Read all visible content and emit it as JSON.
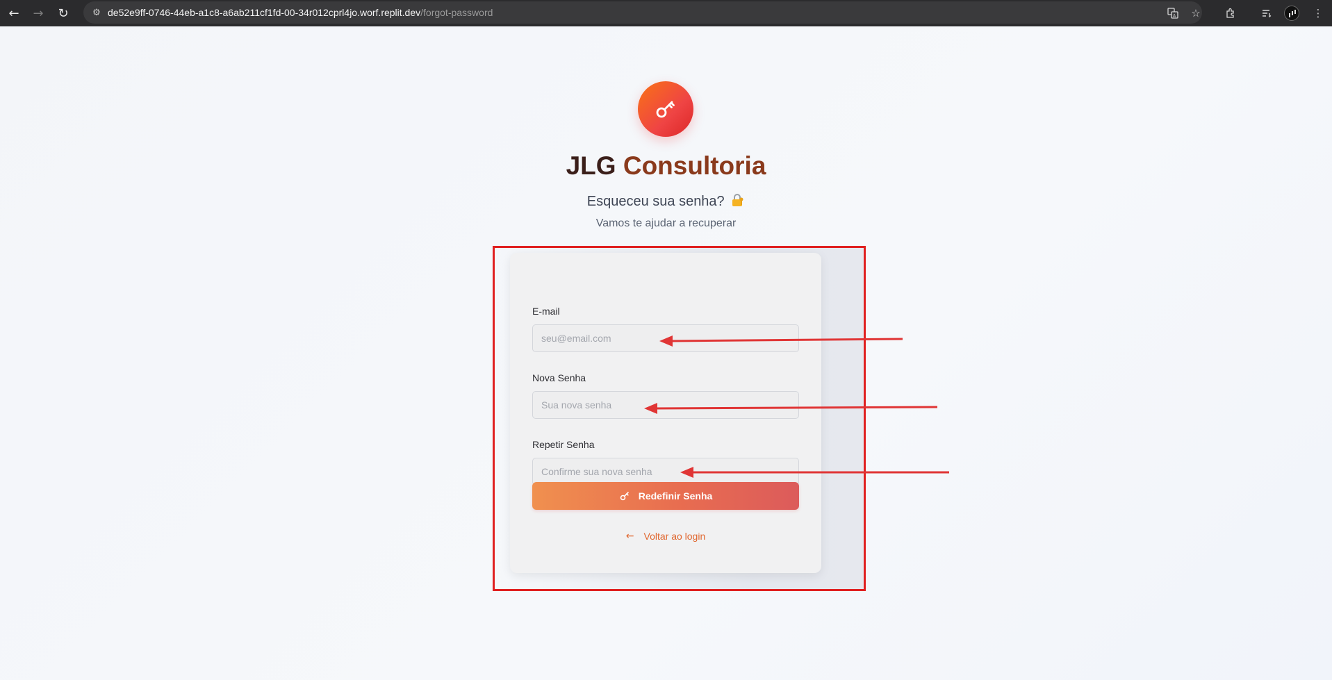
{
  "browser": {
    "url_host": "de52e9ff-0746-44eb-a1c8-a6ab211cf1fd-00-34r012cprl4jo.worf.replit.dev",
    "url_path": "/forgot-password",
    "icons": [
      "back-icon",
      "forward-icon",
      "reload-icon",
      "site-settings-icon",
      "translate-icon",
      "bookmark-star-icon",
      "extensions-icon",
      "reading-list-icon",
      "profile-avatar",
      "menu-icon"
    ]
  },
  "brand": {
    "name_part1": "JLG",
    "name_part2": "Consultoria",
    "logo_icon": "key-icon"
  },
  "header": {
    "subtitle": "Esqueceu sua senha?",
    "subtitle_emoji": "lock-with-key-icon",
    "tagline": "Vamos te ajudar a recuperar"
  },
  "form": {
    "email": {
      "label": "E-mail",
      "placeholder": "seu@email.com",
      "value": ""
    },
    "new_password": {
      "label": "Nova Senha",
      "placeholder": "Sua nova senha",
      "value": ""
    },
    "repeat_password": {
      "label": "Repetir Senha",
      "placeholder": "Confirme sua nova senha",
      "value": ""
    },
    "submit_label": "Redefinir Senha",
    "back_label": "Voltar ao login"
  },
  "colors": {
    "accent_orange": "#f97316",
    "accent_red": "#dc2626",
    "annotation_red": "#e02020",
    "link": "#e0662e"
  }
}
